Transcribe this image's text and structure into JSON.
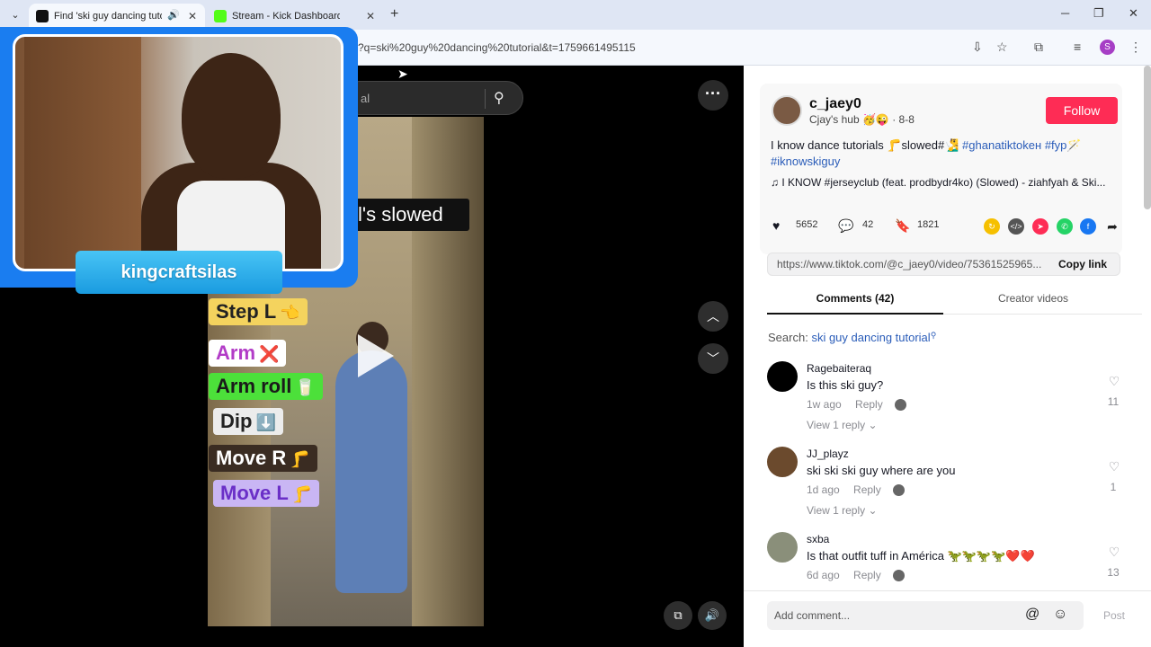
{
  "browser": {
    "tabs": [
      {
        "title": "Find 'ski guy dancing tutori",
        "active": true
      },
      {
        "title": "Stream - Kick Dashboard",
        "active": false
      }
    ],
    "url": "?q=ski%20guy%20dancing%20tutorial&t=1759661495115",
    "profile_initial": "S"
  },
  "video": {
    "search_text": "al",
    "caption": "l's slowed",
    "steps": [
      {
        "label": "Step L",
        "emoji": "👈"
      },
      {
        "label": "Arm",
        "emoji": "❌"
      },
      {
        "label": "Arm roll",
        "emoji": "🥛"
      },
      {
        "label": "Dip",
        "emoji": "⬇️"
      },
      {
        "label": "Move R",
        "emoji": "🦵"
      },
      {
        "label": "Move L",
        "emoji": "🦵"
      }
    ]
  },
  "webcam": {
    "name": "kingcraftsilas"
  },
  "post": {
    "username": "c_jaey0",
    "subtitle": "Cjay's hub 🥳😜 · 8-8",
    "follow_label": "Follow",
    "desc_text": "I know dance tutorials 🦵slowed#🧏‍♂️",
    "desc_tags": [
      "#ghanatiktokен",
      "#fyp🪄",
      "#iknowskiguy"
    ],
    "music": "♫   I KNOW #jerseyclub (feat. prodbydr4ko) (Slowed) - ziahfyah & Ski...",
    "likes": "5652",
    "comments": "42",
    "saves": "1821",
    "link": "https://www.tiktok.com/@c_jaey0/video/75361525965...",
    "copy_label": "Copy link"
  },
  "tabs": {
    "comments": "Comments (42)",
    "creator": "Creator videos"
  },
  "search": {
    "label": "Search:",
    "query": "ski guy dancing tutorial"
  },
  "comments": [
    {
      "name": "Ragebaiteraq",
      "text": "Is this ski guy?",
      "time": "1w ago",
      "reply": "Reply",
      "view": "View 1 reply ⌄",
      "likes": "11"
    },
    {
      "name": "JJ_playz",
      "text": "ski ski ski guy where are you",
      "time": "1d ago",
      "reply": "Reply",
      "view": "View 1 reply ⌄",
      "likes": "1"
    },
    {
      "name": "sxba",
      "text": "Is that outfit tuff in América 🦖🦖🦖🦖❤️❤️",
      "time": "6d ago",
      "reply": "Reply",
      "view": "",
      "likes": "13"
    }
  ],
  "add_comment": {
    "placeholder": "Add comment...",
    "post_label": "Post"
  },
  "colors": {
    "follow": "#fe2c55",
    "tag": "#2b5db9",
    "webcam_frame": "#1a7df0"
  }
}
